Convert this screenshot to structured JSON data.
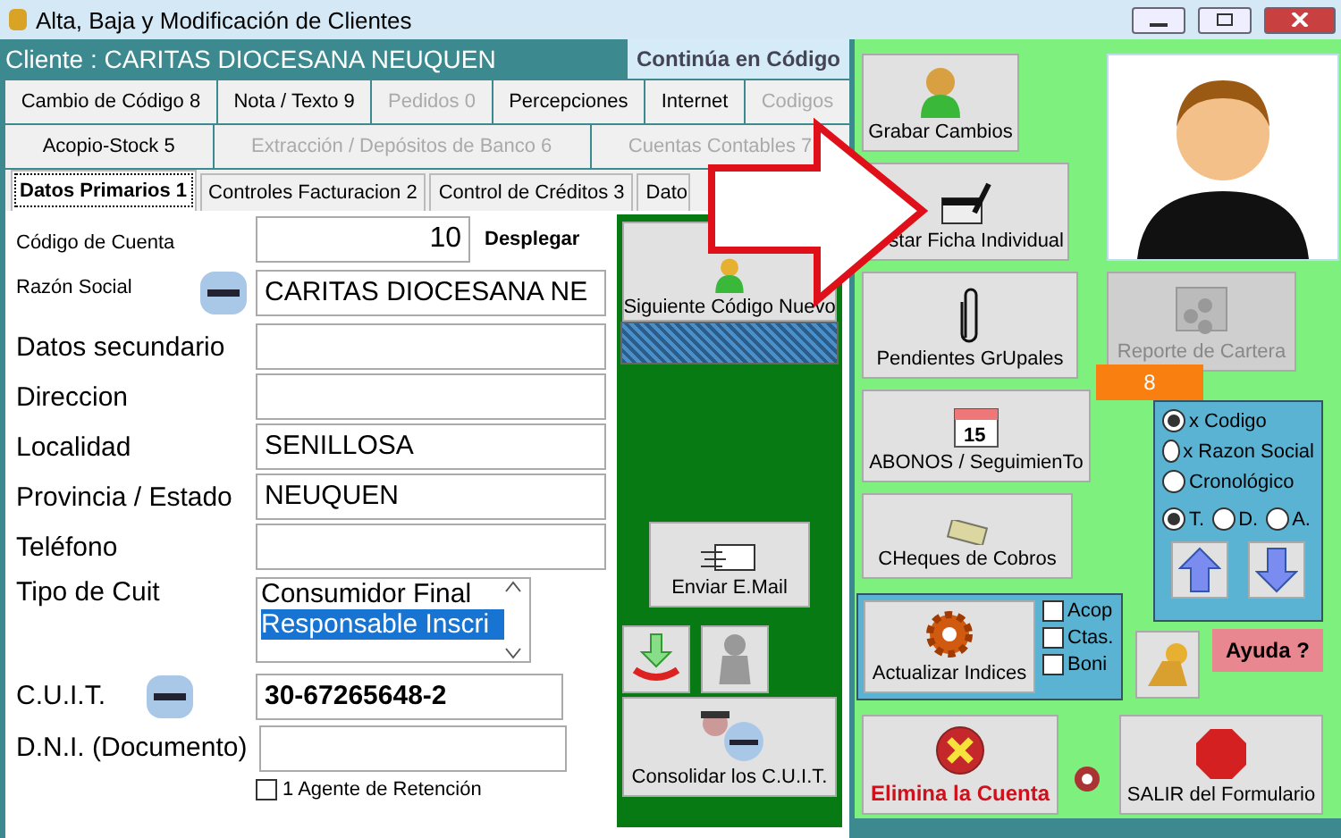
{
  "window": {
    "title": "Alta, Baja y Modificación de Clientes"
  },
  "client_bar": {
    "text": "Cliente : CARITAS DIOCESANA NEUQUEN",
    "button": "Continúa en Código"
  },
  "tab_rows": [
    [
      {
        "label": "Cambio de Código 8",
        "disabled": false
      },
      {
        "label": "Nota / Texto 9",
        "disabled": false
      },
      {
        "label": "Pedidos 0",
        "disabled": true
      },
      {
        "label": "Percepciones",
        "disabled": false
      },
      {
        "label": "Internet",
        "disabled": false
      },
      {
        "label": "Codigos",
        "disabled": true
      }
    ],
    [
      {
        "label": "Acopio-Stock 5",
        "disabled": false
      },
      {
        "label": "Extracción / Depósitos de Banco 6",
        "disabled": true
      },
      {
        "label": "Cuentas Contables 7",
        "disabled": true
      }
    ]
  ],
  "form_tabs": [
    {
      "label": "Datos Primarios 1",
      "selected": true
    },
    {
      "label": "Controles Facturacion 2",
      "selected": false
    },
    {
      "label": "Control de Créditos 3",
      "selected": false
    },
    {
      "label": "Dato",
      "selected": false
    }
  ],
  "form": {
    "account_code": {
      "label": "Código de Cuenta",
      "value": "10",
      "action": "Desplegar"
    },
    "fields": [
      {
        "kind": "small",
        "label": "Razón Social",
        "value": "CARITAS DIOCESANA NE",
        "afip": true
      },
      {
        "kind": "large",
        "label": "Datos secundario",
        "afip": false
      },
      {
        "kind": "large",
        "label": "Direccion",
        "afip": false
      },
      {
        "kind": "large",
        "label": "Localidad",
        "value": "SENILLOSA",
        "afip": false
      },
      {
        "kind": "large",
        "label": "Provincia / Estado",
        "value": "NEUQUEN",
        "afip": false
      },
      {
        "kind": "large",
        "label": "Teléfono",
        "afip": false
      }
    ],
    "cuit_type": {
      "label": "Tipo de Cuit",
      "options": [
        {
          "text": "Consumidor Final",
          "selected": false
        },
        {
          "text": "Responsable Inscri",
          "selected": true
        }
      ]
    },
    "cuit": {
      "label": "C.U.I.T.",
      "value": "30-67265648-2"
    },
    "dni": {
      "label": "D.N.I. (Documento)"
    },
    "retention": {
      "label": "1 Agente de Retención",
      "checked": false
    }
  },
  "green_column": {
    "next_button": "Siguiente Código Nuevo",
    "email_button": "Enviar E.Mail",
    "consolidate_button": "Consolidar los C.U.I.T."
  },
  "actions": {
    "save": "Grabar Cambios",
    "list": "star Ficha Individual",
    "pending": "Pendientes GrUpales",
    "report": {
      "label": "Reporte de Cartera",
      "disabled": true
    },
    "badge": "8",
    "payments": "ABONOS / SeguimienTo",
    "calendar_day": "15",
    "checks": "CHeques de Cobros",
    "sort_options": [
      {
        "label": "x Codigo",
        "selected": true
      },
      {
        "label": "x Razon Social",
        "selected": false
      },
      {
        "label": "Cronológico",
        "selected": false
      }
    ],
    "range_options": [
      {
        "label": "T.",
        "selected": true
      },
      {
        "label": "D.",
        "selected": false
      },
      {
        "label": "A.",
        "selected": false
      }
    ],
    "update": {
      "label": "Actualizar Indices",
      "options": [
        {
          "label": "Acop",
          "checked": false
        },
        {
          "label": "Ctas.",
          "checked": false
        },
        {
          "label": "Boni",
          "checked": false
        }
      ]
    },
    "help": "Ayuda ?",
    "delete": "Elimina la Cuenta",
    "exit": "SALIR del Formulario"
  }
}
